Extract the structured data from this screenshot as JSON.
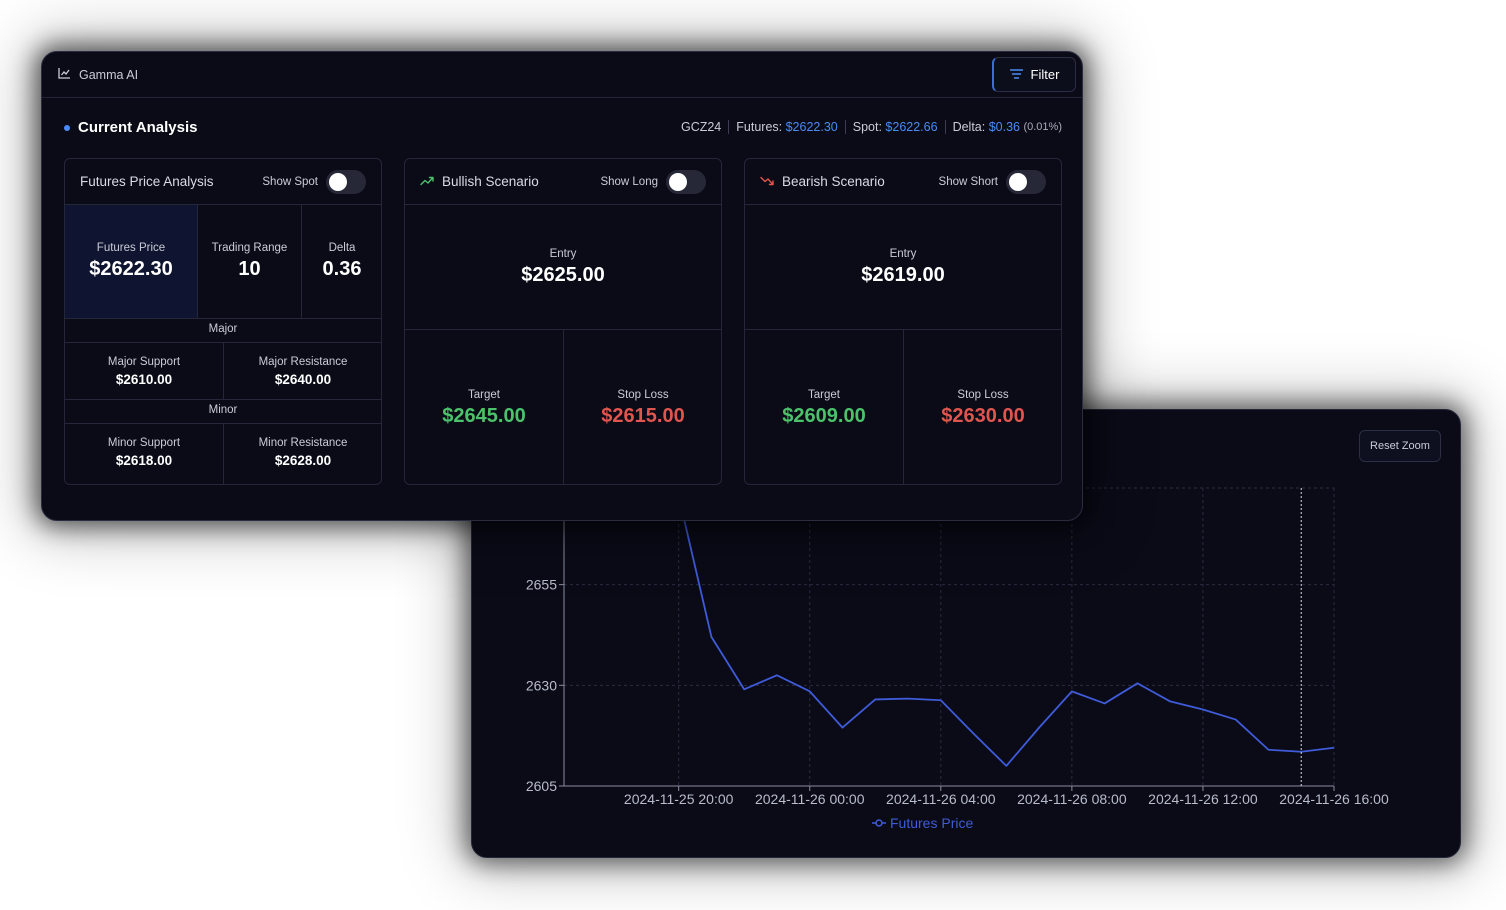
{
  "app": {
    "title": "Gamma AI",
    "filter_label": "Filter",
    "filter_icon": "filter-lines-icon",
    "app_icon": "chart-icon"
  },
  "analysis": {
    "title": "Current Analysis",
    "symbol": "GCZ24",
    "futures_label": "Futures:",
    "futures_value": "$2622.30",
    "spot_label": "Spot:",
    "spot_value": "$2622.66",
    "delta_label": "Delta:",
    "delta_value": "$0.36",
    "delta_pct": "(0.01%)"
  },
  "futures_card": {
    "title": "Futures Price Analysis",
    "toggle_label": "Show Spot",
    "toggle_on": false,
    "futures_price_label": "Futures Price",
    "futures_price_value": "$2622.30",
    "trading_range_label": "Trading Range",
    "trading_range_value": "10",
    "delta_label": "Delta",
    "delta_value": "0.36",
    "major_label": "Major",
    "major_support_label": "Major Support",
    "major_support_value": "$2610.00",
    "major_resistance_label": "Major Resistance",
    "major_resistance_value": "$2640.00",
    "minor_label": "Minor",
    "minor_support_label": "Minor Support",
    "minor_support_value": "$2618.00",
    "minor_resistance_label": "Minor Resistance",
    "minor_resistance_value": "$2628.00"
  },
  "bullish_card": {
    "title": "Bullish Scenario",
    "icon": "trend-up-icon",
    "toggle_label": "Show Long",
    "toggle_on": false,
    "entry_label": "Entry",
    "entry_value": "$2625.00",
    "target_label": "Target",
    "target_value": "$2645.00",
    "stop_label": "Stop Loss",
    "stop_value": "$2615.00"
  },
  "bearish_card": {
    "title": "Bearish Scenario",
    "icon": "trend-down-icon",
    "toggle_label": "Show Short",
    "toggle_on": false,
    "entry_label": "Entry",
    "entry_value": "$2619.00",
    "target_label": "Target",
    "target_value": "$2609.00",
    "stop_label": "Stop Loss",
    "stop_value": "$2630.00"
  },
  "chart": {
    "reset_zoom_label": "Reset Zoom",
    "legend_label": "Futures Price",
    "line_color": "#3f5bd9"
  },
  "chart_data": {
    "type": "line",
    "title": "",
    "xlabel": "",
    "ylabel": "",
    "x_tick_labels": [
      "2024-11-25 20:00",
      "2024-11-26 00:00",
      "2024-11-26 04:00",
      "2024-11-26 08:00",
      "2024-11-26 12:00",
      "2024-11-26 16:00"
    ],
    "y_tick_labels": [
      "2605",
      "2630",
      "2655"
    ],
    "ylim": [
      2605,
      2679
    ],
    "series": [
      {
        "name": "Futures Price",
        "x_hours": [
          17,
          20,
          21,
          22,
          23,
          24,
          25,
          26,
          27,
          28,
          29,
          30,
          31,
          32,
          33,
          34,
          35,
          36,
          37,
          38,
          39,
          40
        ],
        "values": [
          2678,
          2677,
          2642,
          2629,
          2632.5,
          2628.5,
          2619.5,
          2626.5,
          2626.7,
          2626.3,
          2618,
          2610,
          2619.5,
          2628.5,
          2625.5,
          2630.5,
          2626,
          2624,
          2621.5,
          2614,
          2613.5,
          2614.5
        ]
      }
    ],
    "crosshair_x_hours": 39,
    "grid": true,
    "legend": "bottom"
  }
}
